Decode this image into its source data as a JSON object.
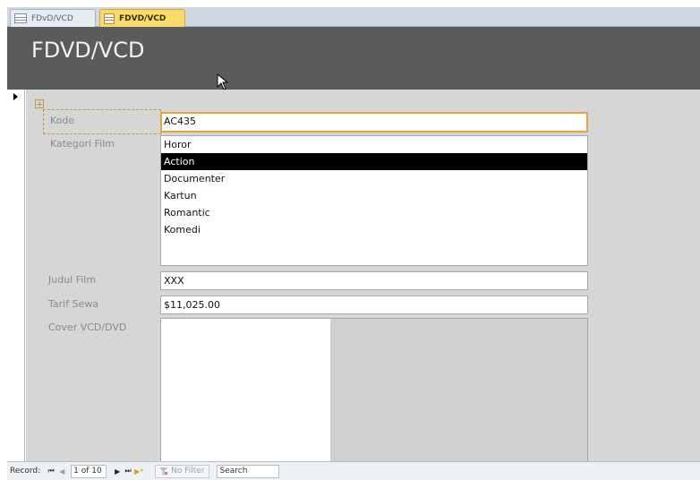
{
  "tabs": [
    {
      "label": "FDvD/VCD",
      "icon": "table-icon",
      "active": false
    },
    {
      "label": "FDVD/VCD",
      "icon": "form-icon",
      "active": true
    }
  ],
  "form": {
    "title": "FDVD/VCD"
  },
  "fields": {
    "kode": {
      "label": "Kode",
      "value": "AC435"
    },
    "kategori": {
      "label": "Kategori Film",
      "options": [
        "Horor",
        "Action",
        "Documenter",
        "Kartun",
        "Romantic",
        "Komedi"
      ],
      "selected": "Action"
    },
    "judul": {
      "label": "Judul Film",
      "value": "XXX"
    },
    "tarif": {
      "label": "Tarif Sewa",
      "value": "$11,025.00"
    },
    "cover": {
      "label": "Cover VCD/DVD"
    }
  },
  "navbar": {
    "record_label": "Record:",
    "first": "⏮",
    "prev": "◀",
    "current": "1 of 10",
    "next": "▶",
    "last": "⏭",
    "new": "▶*",
    "filter_icon": "funnel-icon",
    "filter_label": "No Filter",
    "search_label": "Search"
  },
  "colors": {
    "header_bg": "#5b5b5b",
    "detail_bg": "#d6d6d6",
    "active_tab": "#fcd96b",
    "focus_border": "#f2a03b",
    "selected_item": "#000000"
  }
}
